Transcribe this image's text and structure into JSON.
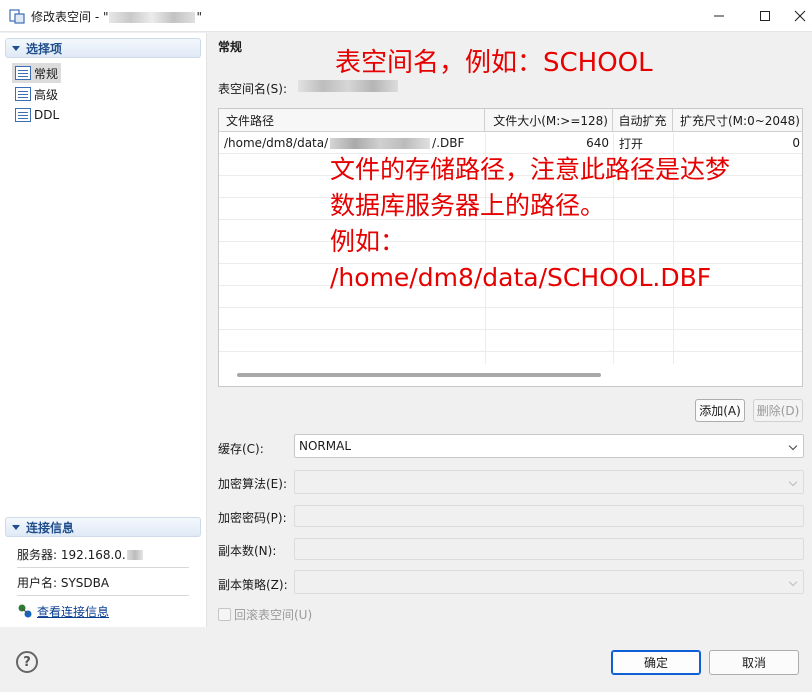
{
  "window": {
    "title_prefix": "修改表空间 - \"",
    "title_suffix": "\"",
    "help_glyph": "?",
    "minimize_glyph": "—",
    "maximize_glyph": "☐",
    "close_glyph": "✕"
  },
  "sidebar": {
    "section_title": "选择项",
    "items": [
      {
        "label": "常规",
        "icon": "document-icon",
        "selected": true
      },
      {
        "label": "高级",
        "icon": "document-icon",
        "selected": false
      },
      {
        "label": "DDL",
        "icon": "document-icon",
        "selected": false
      }
    ],
    "connection": {
      "section_title": "连接信息",
      "server_label": "服务器: 192.168.0.",
      "user_label": "用户名: SYSDBA",
      "link_label": "查看连接信息"
    }
  },
  "main": {
    "group_title": "常规",
    "tablespace_name_label": "表空间名(S):",
    "table": {
      "headers": [
        "文件路径",
        "文件大小(M:>=128)",
        "自动扩充",
        "扩充尺寸(M:0~2048)"
      ],
      "rows": [
        {
          "path_prefix": "/home/dm8/data/",
          "path_suffix": "/.DBF",
          "size": "640",
          "auto_extend": "打开",
          "extend_size": "0"
        }
      ]
    },
    "add_button": "添加(A)",
    "delete_button": "删除(D)",
    "cache_label": "缓存(C):",
    "cache_value": "NORMAL",
    "encrypt_algo_label": "加密算法(E):",
    "encrypt_pwd_label": "加密密码(P):",
    "copies_label": "副本数(N):",
    "copy_policy_label": "副本策略(Z):",
    "rollback_label": "回滚表空间(U)"
  },
  "footer": {
    "help_glyph": "?",
    "ok_button": "确定",
    "cancel_button": "取消"
  },
  "annotations": {
    "name_hint": "表空间名，例如：SCHOOL",
    "path_hint_lines": [
      "文件的存储路径，注意此路径是达梦",
      "数据库服务器上的路径。",
      "例如：",
      "/home/dm8/data/SCHOOL.DBF"
    ]
  },
  "colors": {
    "accent": "#1f4e8c",
    "annotation": "#e60000",
    "primary_border": "#0f5fd6"
  }
}
